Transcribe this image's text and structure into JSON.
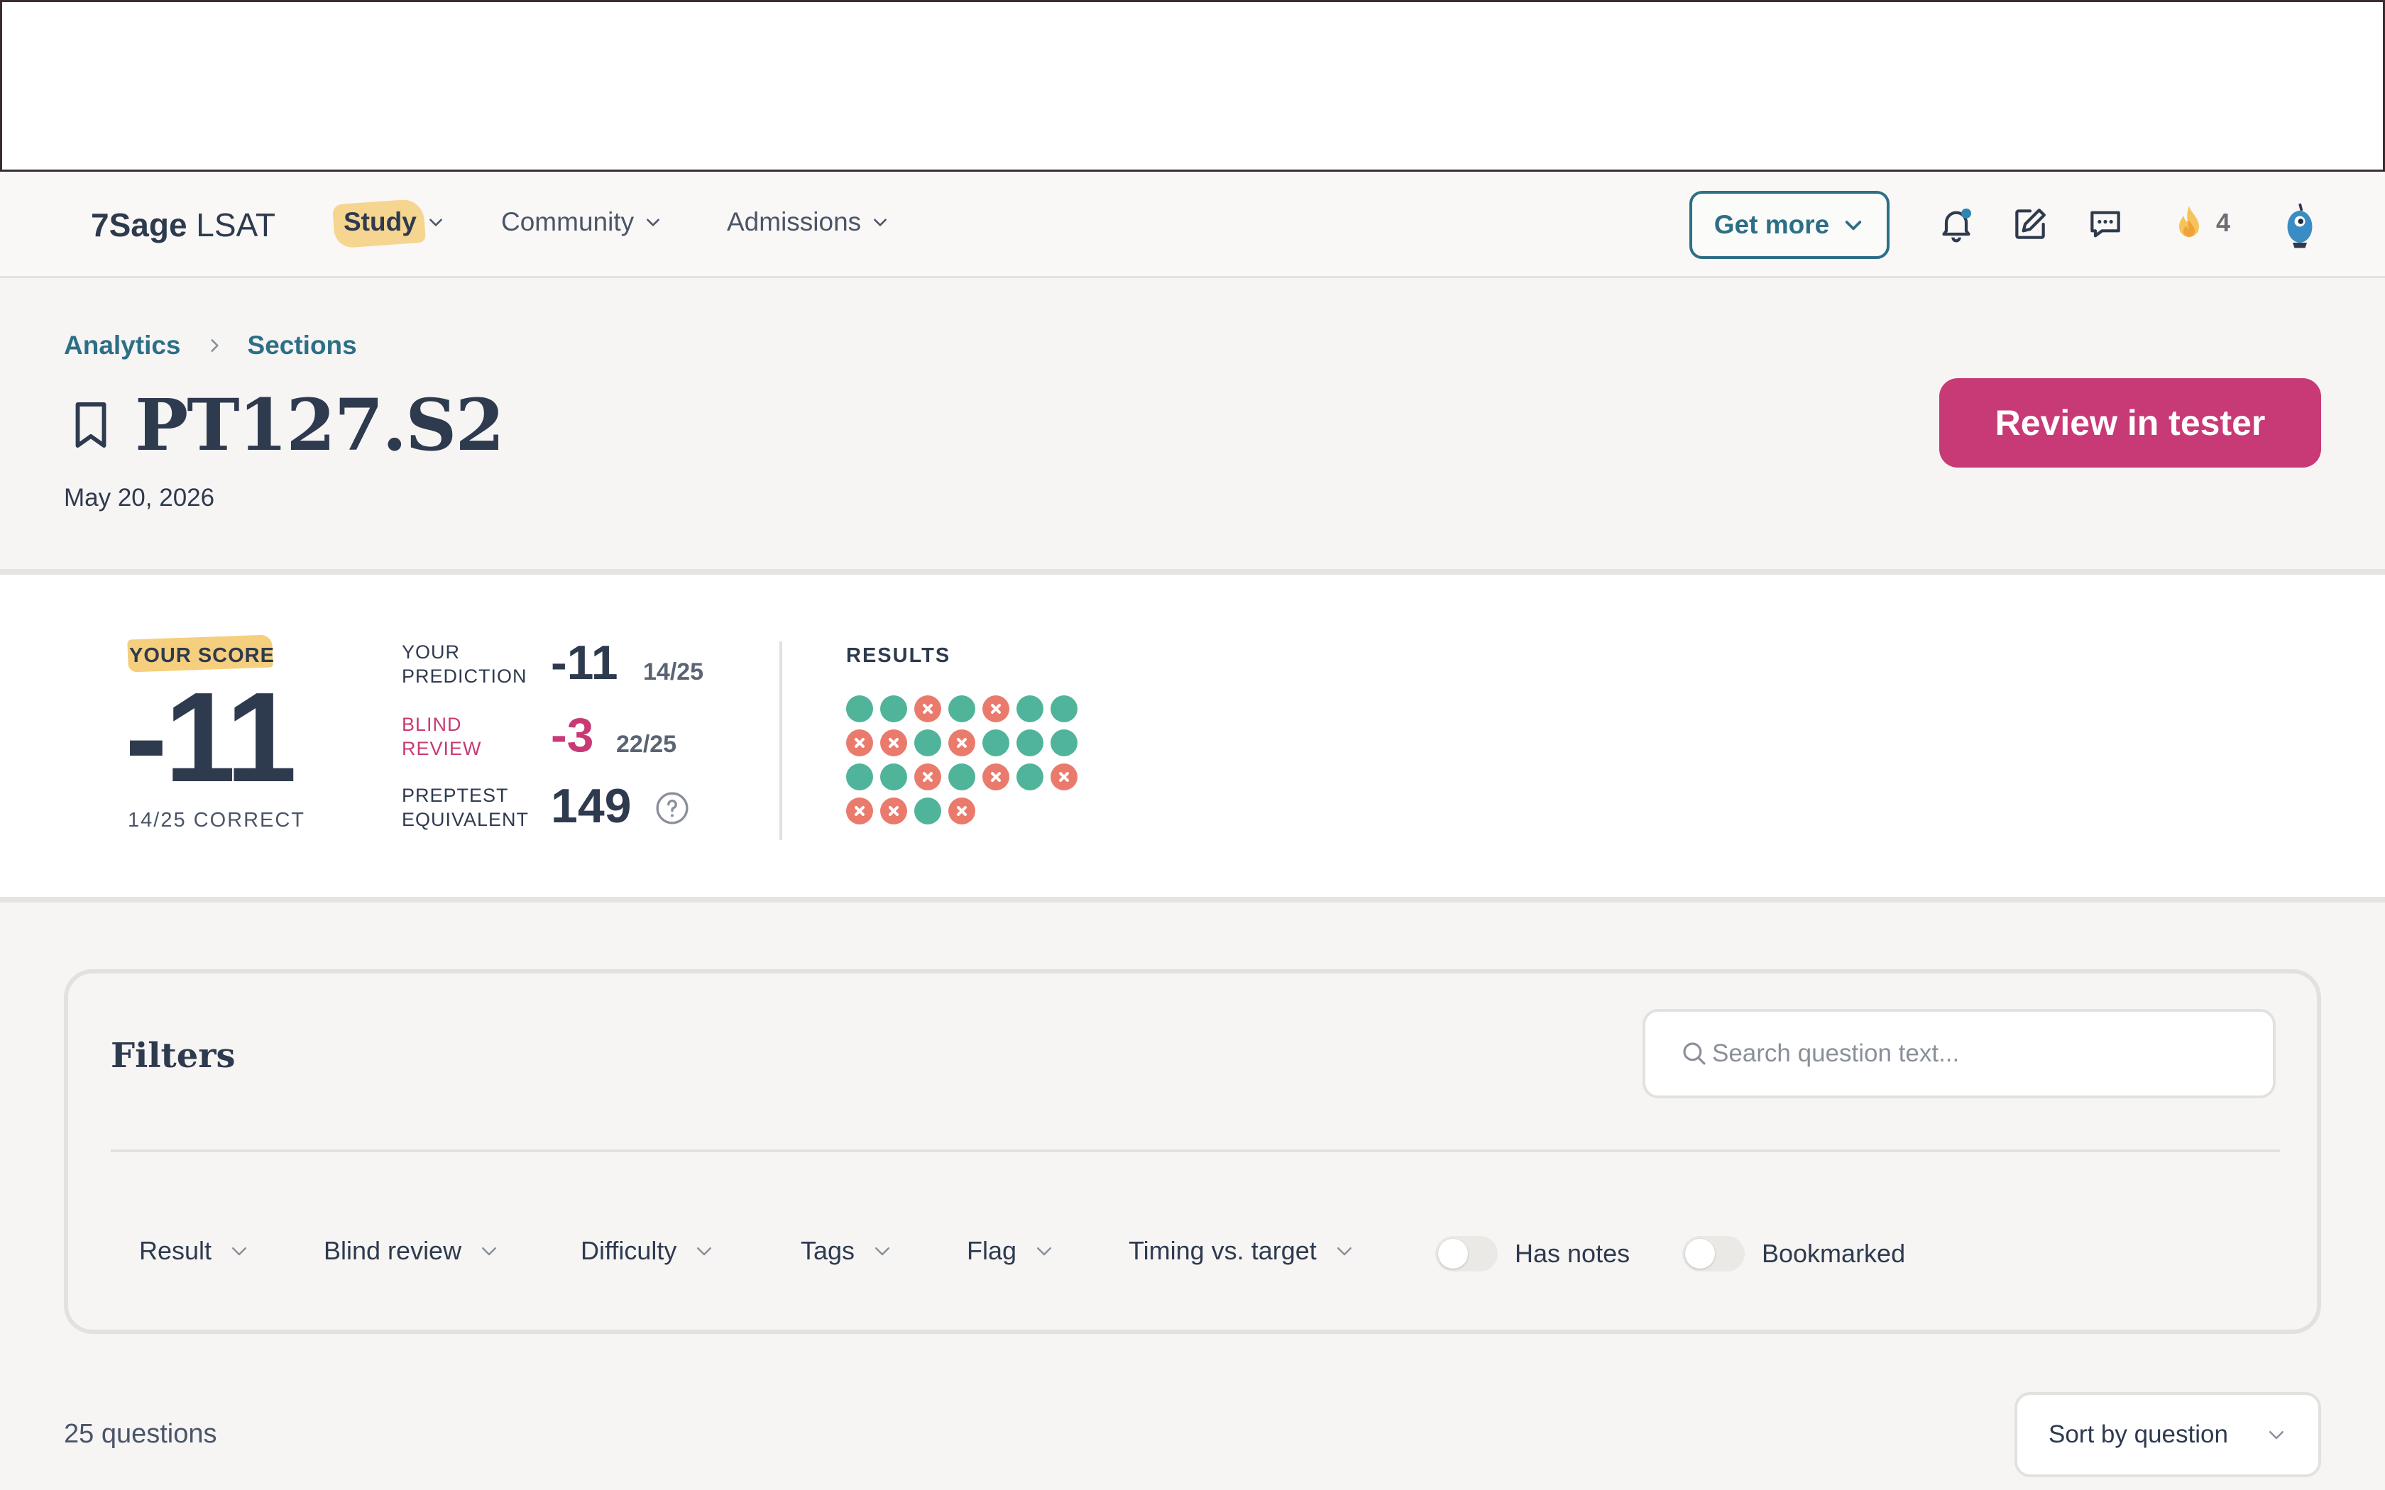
{
  "nav": {
    "brand_bold": "7Sage",
    "brand_rest": " LSAT",
    "items": [
      {
        "label": "Study"
      },
      {
        "label": "Community"
      },
      {
        "label": "Admissions"
      }
    ],
    "get_more_label": "Get more",
    "streak_count": "4"
  },
  "breadcrumb": [
    "Analytics",
    "Sections"
  ],
  "page": {
    "title": "PT127.S2",
    "date": "May 20, 2026",
    "review_button": "Review in tester"
  },
  "score": {
    "your_score_label": "YOUR SCORE",
    "value": "-11",
    "correct_label": "14/25 CORRECT",
    "prediction_label_1": "YOUR",
    "prediction_label_2": "PREDICTION",
    "prediction_value": "-11",
    "prediction_sub": "14/25",
    "blind_label_1": "BLIND",
    "blind_label_2": "REVIEW",
    "blind_value": "-3",
    "blind_sub": "22/25",
    "preptest_label_1": "PREPTEST",
    "preptest_label_2": "EQUIVALENT",
    "preptest_value": "149",
    "results_label": "RESULTS",
    "results": [
      1,
      1,
      0,
      1,
      0,
      1,
      1,
      0,
      0,
      1,
      0,
      1,
      1,
      1,
      1,
      1,
      0,
      1,
      0,
      1,
      0,
      0,
      0,
      1,
      0
    ]
  },
  "filters": {
    "title": "Filters",
    "search_placeholder": "Search question text...",
    "dropdowns": [
      "Result",
      "Blind review",
      "Difficulty",
      "Tags",
      "Flag",
      "Timing vs. target"
    ],
    "toggles": [
      "Has notes",
      "Bookmarked"
    ]
  },
  "list": {
    "count_label": "25 questions",
    "sort_label": "Sort by question"
  },
  "colors": {
    "accent_teal": "#2c6f86",
    "accent_pink": "#c83a75",
    "correct": "#4fb49a",
    "incorrect": "#ea7b6c",
    "highlight": "#f5cf7e"
  }
}
